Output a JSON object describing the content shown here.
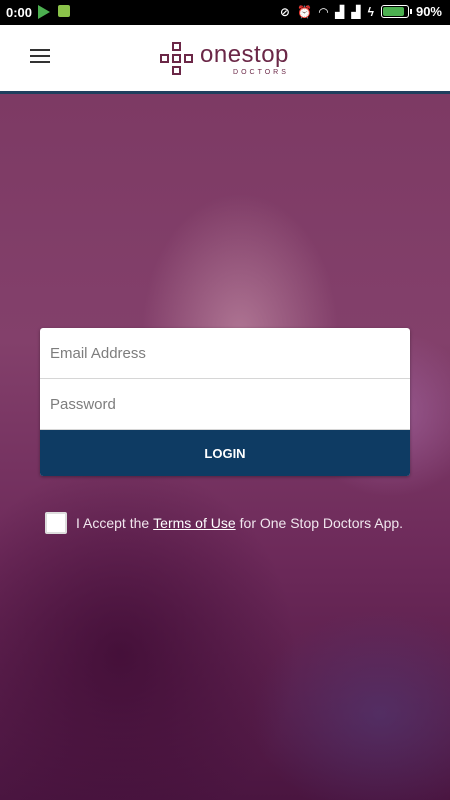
{
  "status_bar": {
    "time": "0:00",
    "battery_percent": "90%",
    "battery_level": 0.9,
    "icons": [
      "play-store-icon",
      "android-icon",
      "mute-icon",
      "alarm-icon",
      "wifi-icon",
      "signal-icon",
      "signal-icon",
      "charging-icon",
      "battery-icon"
    ]
  },
  "app_bar": {
    "logo_name": "onestop",
    "logo_sub": "DOCTORS",
    "brand_color": "#6b2747",
    "accent_line_color": "#1f3f5e"
  },
  "login_form": {
    "email_placeholder": "Email Address",
    "password_placeholder": "Password",
    "login_label": "LOGIN",
    "login_color": "#0e3b63"
  },
  "terms": {
    "prefix": "I Accept the",
    "link_text": "Terms of Use",
    "suffix": "for One Stop Doctors App.",
    "checked": false
  }
}
